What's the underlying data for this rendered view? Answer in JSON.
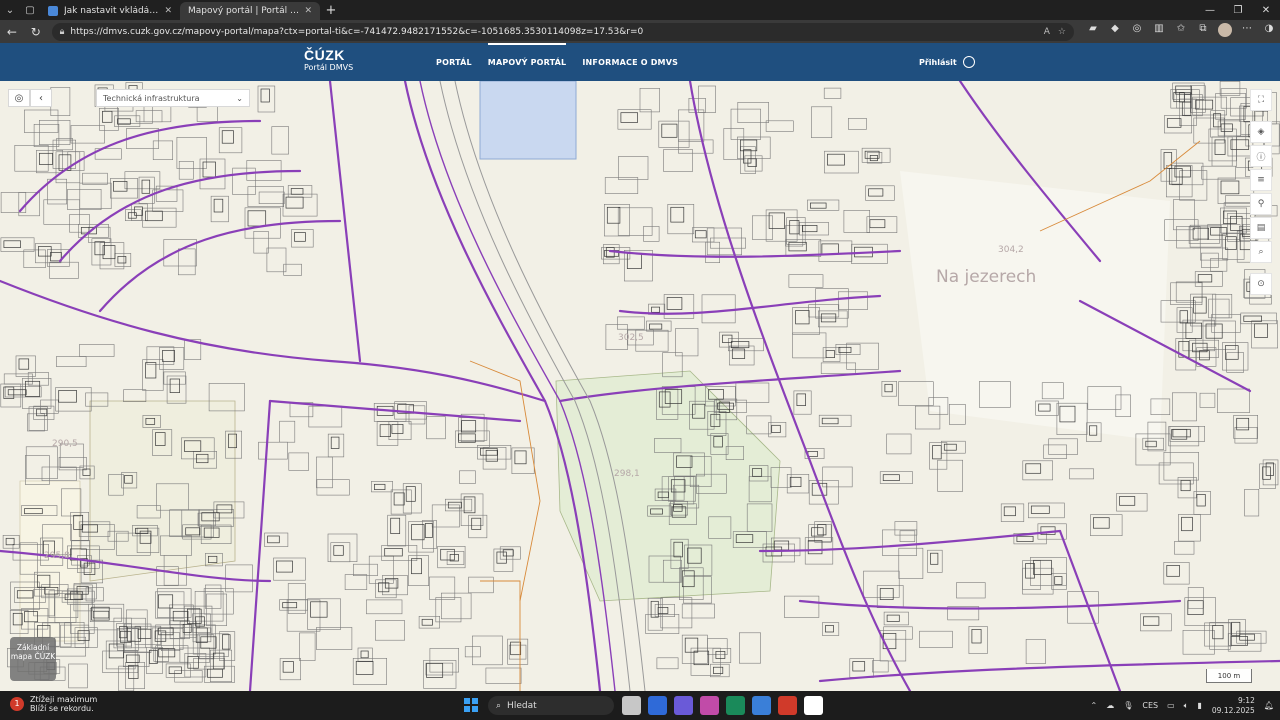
{
  "browser": {
    "tabs": [
      {
        "label": "Jak nastavit vkládání vektorových",
        "favicon_color": "#4a88d8"
      },
      {
        "label": "Mapový portál | Portál DMVS (ČÚ",
        "favicon_color": "#1f4f7f"
      }
    ],
    "new_tab_glyph": "+",
    "url": "https://dmvs.cuzk.gov.cz/mapovy-portal/mapa?ctx=portal-ti&c=-741472.9482171552&c=-1051685.3530114098z=17.53&r=0"
  },
  "site": {
    "logo_brand": "ČÚZK",
    "logo_sub": "Portál DMVS",
    "nav": [
      {
        "label": "PORTÁL",
        "active": false
      },
      {
        "label": "MAPOVÝ PORTÁL",
        "active": true
      },
      {
        "label": "INFORMACE O DMVS",
        "active": false
      }
    ],
    "login_label": "Přihlásit"
  },
  "map": {
    "layer_select": "Technická infrastruktura",
    "basemap_button": "Základní mapa ČÚZK",
    "scale_label": "100 m",
    "place_labels": {
      "jezerech": "Na jezerech",
      "spot1": "302,5",
      "spot2": "304,2",
      "spot3": "290,5",
      "spot4": "295,8",
      "spot5": "298,1"
    },
    "colors": {
      "background": "#f2f0e6",
      "parcel": "#6b6b6b",
      "utility_line": "#8a3fb8",
      "water_area": "#c9d8f0",
      "green_area": "#e4edd6"
    }
  },
  "taskbar": {
    "notification_title": "Ztížeji maximum",
    "notification_text": "Blíží se rekordu.",
    "notification_badge": "1",
    "search_placeholder": "Hledat",
    "lang": "CES",
    "time": "9:12",
    "date": "09.12.2025",
    "app_colors": [
      "#c7c7c7",
      "#2f6ad8",
      "#6a5ad8",
      "#c14ba8",
      "#1a8a5a",
      "#3a7fd8",
      "#d03a2a",
      "#ffffff"
    ]
  }
}
